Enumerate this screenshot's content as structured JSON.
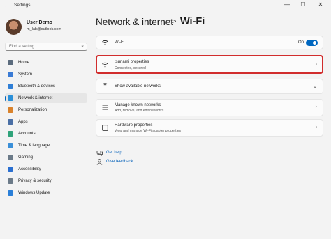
{
  "window": {
    "title": "Settings",
    "back": "←",
    "minimize": "—",
    "maximize": "☐",
    "close": "✕"
  },
  "user": {
    "name": "User Demo",
    "email": "m_lab@outlook.com"
  },
  "search": {
    "placeholder": "Find a setting",
    "icon": "⌕"
  },
  "nav": [
    {
      "label": "Home",
      "icon": "home-icon",
      "color": "#5b6b7d"
    },
    {
      "label": "System",
      "icon": "system-icon",
      "color": "#3a7bd5"
    },
    {
      "label": "Bluetooth & devices",
      "icon": "bluetooth-icon",
      "color": "#2f7fd6"
    },
    {
      "label": "Network & internet",
      "icon": "network-icon",
      "color": "#2a8fd8",
      "active": true
    },
    {
      "label": "Personalization",
      "icon": "brush-icon",
      "color": "#d9822b"
    },
    {
      "label": "Apps",
      "icon": "apps-icon",
      "color": "#4a6fa5"
    },
    {
      "label": "Accounts",
      "icon": "accounts-icon",
      "color": "#2fa37a"
    },
    {
      "label": "Time & language",
      "icon": "globe-icon",
      "color": "#3a8fd8"
    },
    {
      "label": "Gaming",
      "icon": "gaming-icon",
      "color": "#6b7a88"
    },
    {
      "label": "Accessibility",
      "icon": "accessibility-icon",
      "color": "#2a6fd0"
    },
    {
      "label": "Privacy & security",
      "icon": "shield-icon",
      "color": "#6b7a88"
    },
    {
      "label": "Windows Update",
      "icon": "update-icon",
      "color": "#2a7fd8"
    }
  ],
  "breadcrumb": {
    "parent": "Network & internet",
    "separator": ">",
    "current": "Wi-Fi"
  },
  "cards": {
    "wifi": {
      "label": "Wi-Fi",
      "toggle_text": "On",
      "toggle_on": true
    },
    "properties": {
      "label": "tsunami properties",
      "sub": "Connected, secured"
    },
    "available": {
      "label": "Show available networks"
    },
    "known": {
      "label": "Manage known networks",
      "sub": "Add, remove, and edit networks"
    },
    "hardware": {
      "label": "Hardware properties",
      "sub": "View and manage Wi-Fi adapter properties"
    }
  },
  "links": {
    "help": "Get help",
    "feedback": "Give feedback"
  },
  "colors": {
    "accent": "#0067c0",
    "highlight": "#d12d2d",
    "link": "#005fb8"
  }
}
